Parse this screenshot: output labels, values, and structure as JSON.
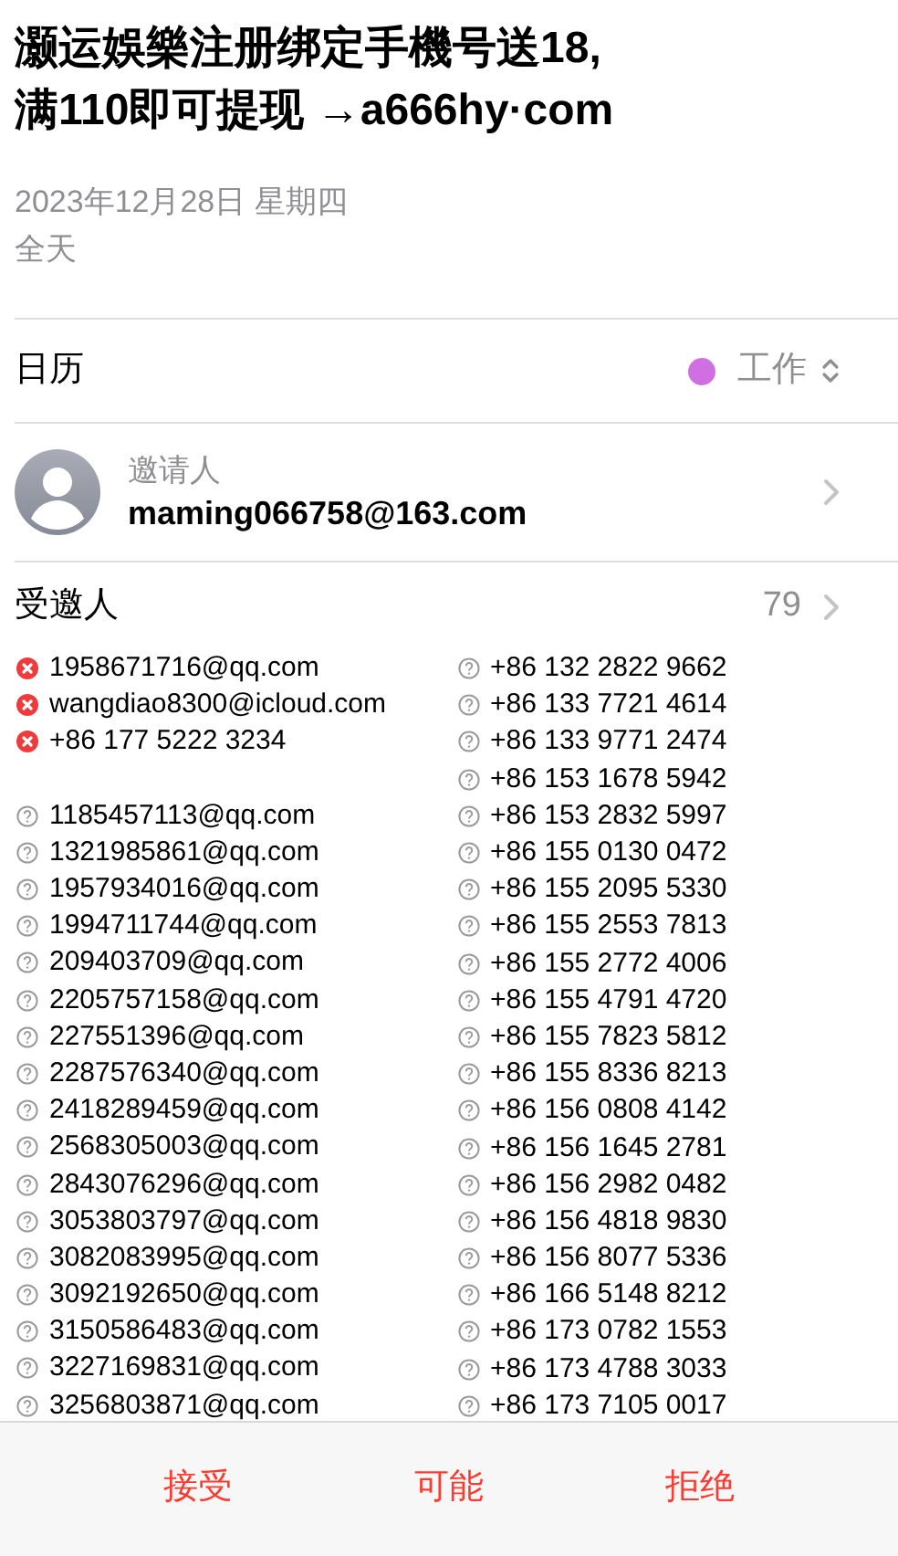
{
  "event": {
    "title_lines": [
      "灏运娛樂注册绑定手機号送18,",
      "满110即可提现 →a666hy·com"
    ],
    "date": "2023年12月28日 星期四",
    "time": "全天"
  },
  "calendar": {
    "label": "日历",
    "name": "工作",
    "color": "#d070e0"
  },
  "inviter": {
    "label": "邀请人",
    "email": "maming066758@163.com"
  },
  "invitees": {
    "label": "受邀人",
    "count": "79",
    "columns": [
      {
        "groups": [
          {
            "kind": "declined",
            "items": [
              "1958671716@qq.com",
              "wangdiao8300@icloud.com",
              "+86 177 5222 3234"
            ]
          },
          {
            "kind": "pending",
            "items": [
              "1185457113@qq.com",
              "1321985861@qq.com",
              "1957934016@qq.com",
              "1994711744@qq.com",
              "209403709@qq.com",
              "2205757158@qq.com",
              "227551396@qq.com",
              "2287576340@qq.com",
              "2418289459@qq.com",
              "2568305003@qq.com",
              "2843076296@qq.com",
              "3053803797@qq.com",
              "3082083995@qq.com",
              "3092192650@qq.com",
              "3150586483@qq.com",
              "3227169831@qq.com",
              "3256803871@qq.com"
            ]
          }
        ]
      },
      {
        "groups": [
          {
            "kind": "pending",
            "items": [
              "+86 132 2822 9662",
              "+86 133 7721 4614",
              "+86 133 9771 2474",
              "+86 153 1678 5942",
              "+86 153 2832 5997",
              "+86 155 0130 0472",
              "+86 155 2095 5330",
              "+86 155 2553 7813",
              "+86 155 2772 4006",
              "+86 155 4791 4720",
              "+86 155 7823 5812",
              "+86 155 8336 8213",
              "+86 156 0808 4142",
              "+86 156 1645 2781",
              "+86 156 2982 0482",
              "+86 156 4818 9830",
              "+86 156 8077 5336",
              "+86 166 5148 8212",
              "+86 173 0782 1553",
              "+86 173 4788 3033",
              "+86 173 7105 0017"
            ]
          }
        ]
      }
    ]
  },
  "actions": [
    "接受",
    "可能",
    "拒绝"
  ]
}
